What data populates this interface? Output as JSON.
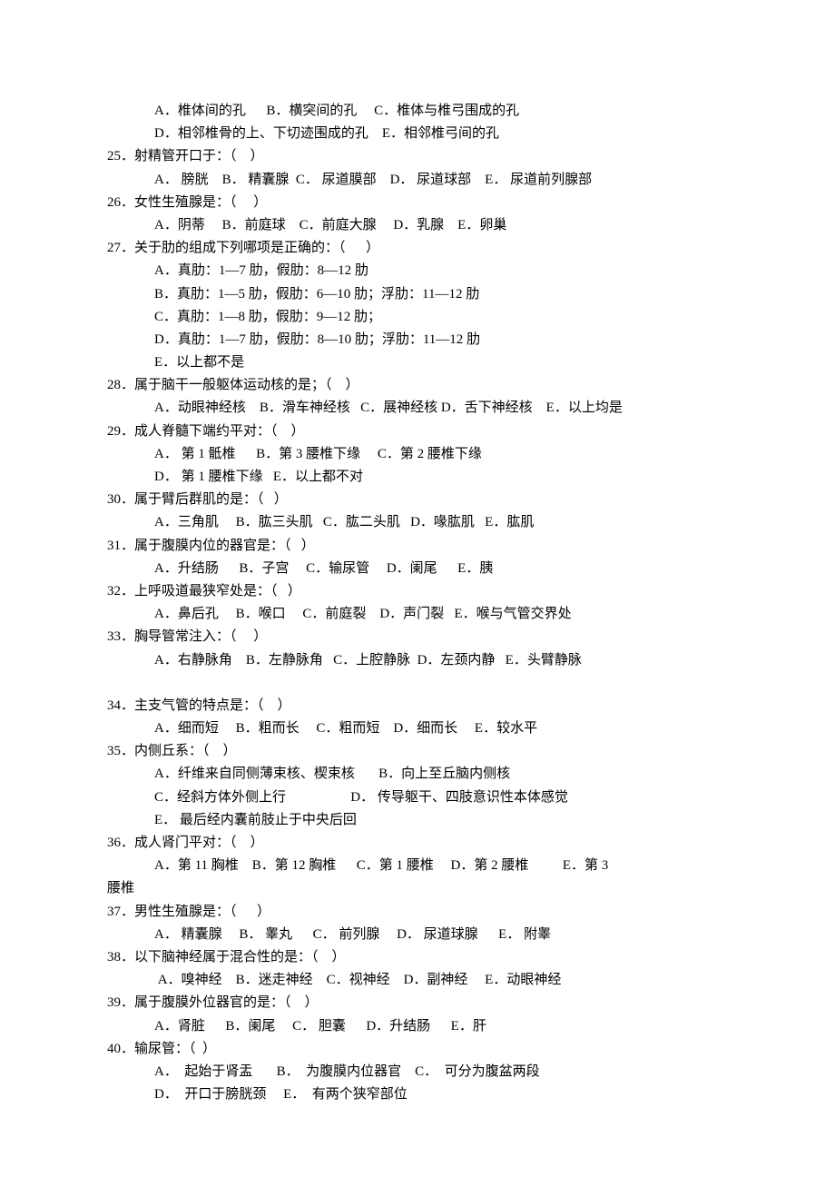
{
  "questions": [
    {
      "num": "",
      "stem": "",
      "option_lines": [
        "A．椎体间的孔      B．横突间的孔     C．椎体与椎弓围成的孔",
        "D．相邻椎骨的上、下切迹围成的孔    E．相邻椎弓间的孔"
      ]
    },
    {
      "num": "25．",
      "stem": "射精管开口于：（    ）",
      "option_lines": [
        "A． 膀胱    B． 精囊腺  C． 尿道膜部    D． 尿道球部    E． 尿道前列腺部"
      ]
    },
    {
      "num": "26．",
      "stem": "女性生殖腺是：（     ）",
      "option_lines": [
        "A．阴蒂     B．前庭球    C．前庭大腺     D．乳腺    E．卵巢"
      ]
    },
    {
      "num": "27．",
      "stem": "关于肋的组成下列哪项是正确的：（      ）",
      "option_lines": [
        "A．真肋：1—7 肋，假肋：8—12 肋",
        "B．真肋：1—5 肋，假肋：6—10 肋；浮肋：11—12 肋",
        "C．真肋：1—8 肋，假肋：9—12 肋；",
        "D．真肋：1—7 肋，假肋：8—10 肋；浮肋：11—12 肋",
        "E．以上都不是"
      ]
    },
    {
      "num": "28．",
      "stem": "属于脑干一般躯体运动核的是；（    ）",
      "option_lines": [
        "A．动眼神经核    B．滑车神经核   C．展神经核 D．舌下神经核    E．以上均是"
      ]
    },
    {
      "num": "29．",
      "stem": "成人脊髓下端约平对：（    ）",
      "option_lines": [
        "A． 第 1 骶椎      B．第 3 腰椎下缘     C．第 2 腰椎下缘",
        "D． 第 1 腰椎下缘   E．以上都不对"
      ]
    },
    {
      "num": "30．",
      "stem": "属于臂后群肌的是：（   ）",
      "option_lines": [
        "A．三角肌     B．肱三头肌   C．肱二头肌   D．喙肱肌   E．肱肌"
      ]
    },
    {
      "num": "31．",
      "stem": "属于腹膜内位的器官是：（   ）",
      "option_lines": [
        "A．升结肠      B．子宫     C．输尿管     D．阑尾      E．胰"
      ]
    },
    {
      "num": "32．",
      "stem": "上呼吸道最狭窄处是：（   ）",
      "option_lines": [
        "A．鼻后孔     B．喉口     C．前庭裂    D．声门裂   E．喉与气管交界处"
      ]
    },
    {
      "num": "33．",
      "stem": "胸导管常注入：（     ）",
      "option_lines": [
        "A．右静脉角    B．左静脉角   C．上腔静脉  D．左颈内静   E．头臂静脉",
        ""
      ]
    },
    {
      "num": "34．",
      "stem": "主支气管的特点是：（    ）",
      "option_lines": [
        "A．细而短     B．粗而长     C．粗而短    D．细而长     E．较水平"
      ]
    },
    {
      "num": "35．",
      "stem": "内侧丘系：（    ）",
      "option_lines": [
        "A．纤维来自同侧薄束核、楔束核       B．向上至丘脑内侧核",
        "C．经斜方体外侧上行                   D． 传导躯干、四肢意识性本体感觉",
        "E． 最后经内囊前肢止于中央后回"
      ]
    },
    {
      "num": "36．",
      "stem": "成人肾门平对：（    ）",
      "option_lines": [
        "A．第 11 胸椎    B．第 12 胸椎      C．第 1 腰椎     D．第 2 腰椎          E．第 3"
      ],
      "has_wrap": true,
      "wrap_text": "腰椎"
    },
    {
      "num": "37．",
      "stem": "男性生殖腺是：（      ）",
      "option_lines": [
        "A． 精囊腺     B． 睾丸      C． 前列腺     D． 尿道球腺      E． 附睾"
      ]
    },
    {
      "num": "38．",
      "stem": "以下脑神经属于混合性的是：（    ）",
      "option_lines": [
        " A．嗅神经    B．迷走神经    C．视神经    D．副神经     E．动眼神经"
      ]
    },
    {
      "num": "39．",
      "stem": "属于腹膜外位器官的是：（    ）",
      "option_lines": [
        "A．肾脏      B．阑尾     C． 胆囊      D．升结肠      E．肝"
      ]
    },
    {
      "num": "40．",
      "stem": "输尿管：（  ）",
      "option_lines": [
        "A．  起始于肾盂       B．  为腹膜内位器官    C．  可分为腹盆两段",
        "D．  开口于膀胱颈     E．  有两个狭窄部位"
      ]
    }
  ]
}
